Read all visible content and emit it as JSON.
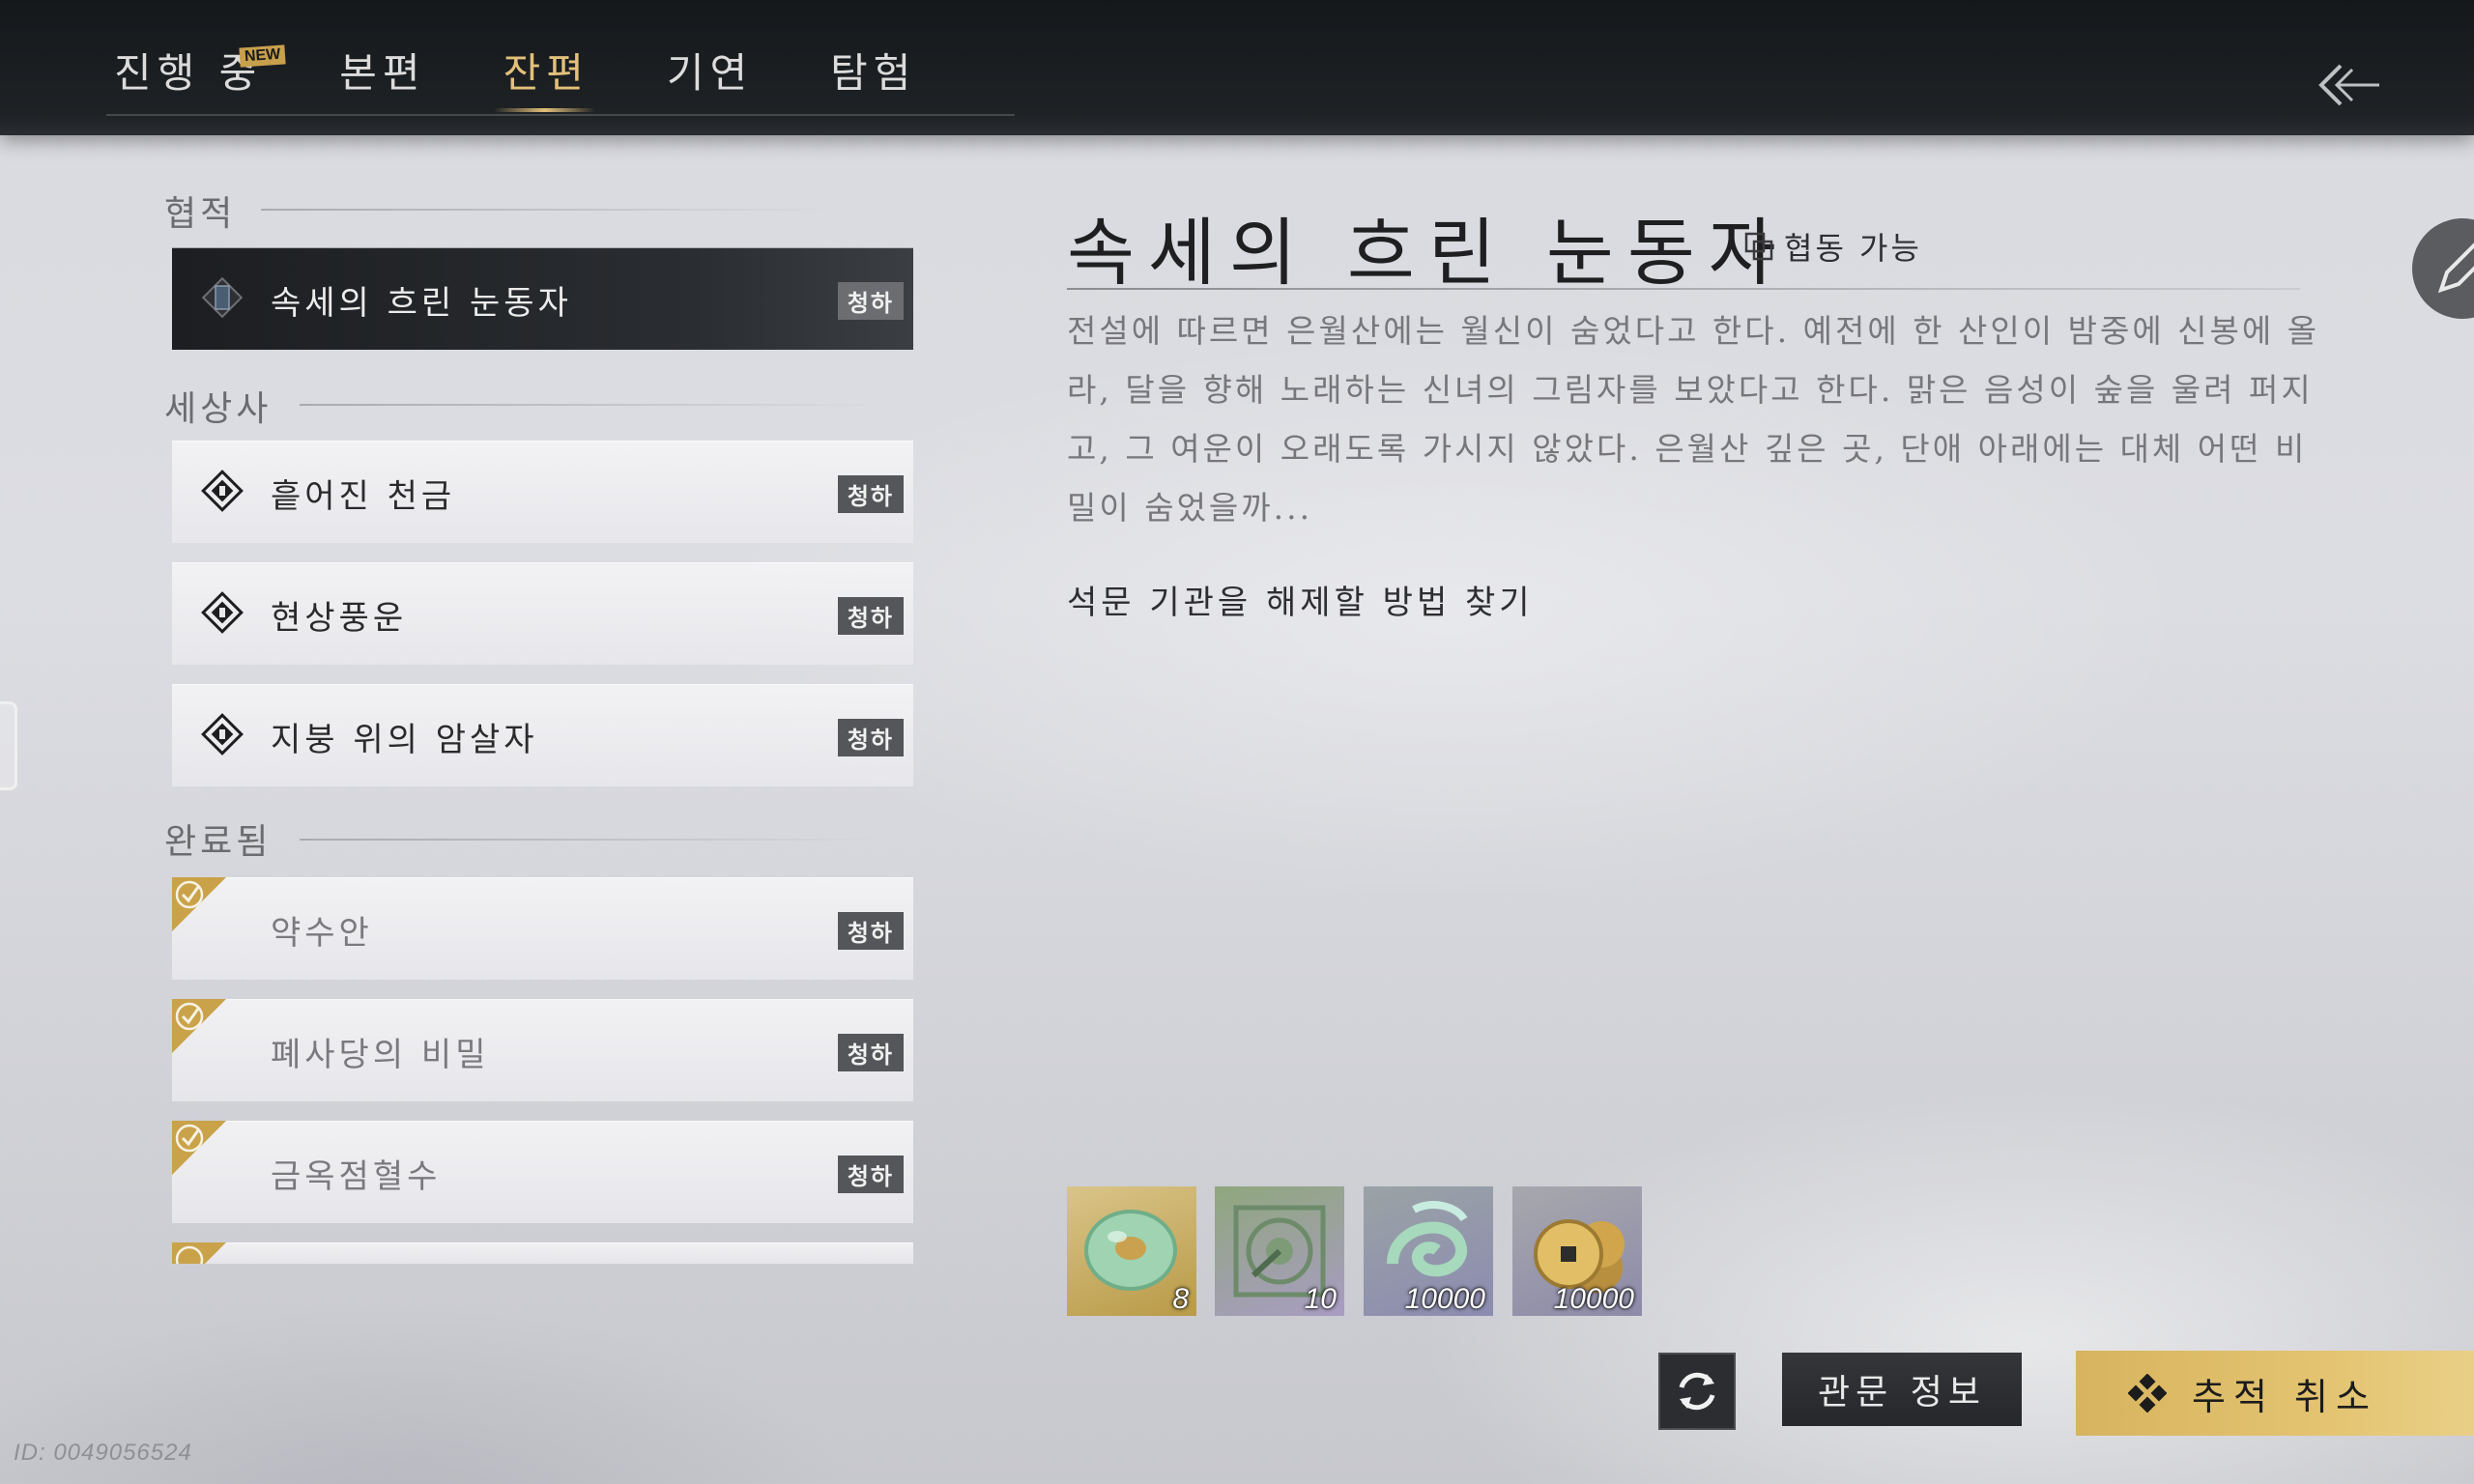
{
  "header": {
    "tabs": [
      {
        "label": "진행 중",
        "badge": "NEW"
      },
      {
        "label": "본편"
      },
      {
        "label": "잔편",
        "active": true
      },
      {
        "label": "기연"
      },
      {
        "label": "탐험"
      }
    ]
  },
  "quest_list": {
    "sections": [
      {
        "title": "협적",
        "items": [
          {
            "label": "속세의 흐린 눈동자",
            "tag": "청하",
            "selected": true
          }
        ]
      },
      {
        "title": "세상사",
        "items": [
          {
            "label": "흩어진 천금",
            "tag": "청하"
          },
          {
            "label": "현상풍운",
            "tag": "청하"
          },
          {
            "label": "지붕 위의 암살자",
            "tag": "청하"
          }
        ]
      },
      {
        "title": "완료됨",
        "items": [
          {
            "label": "약수안",
            "tag": "청하",
            "completed": true
          },
          {
            "label": "폐사당의 비밀",
            "tag": "청하",
            "completed": true
          },
          {
            "label": "금옥점혈수",
            "tag": "청하",
            "completed": true
          }
        ]
      }
    ]
  },
  "detail": {
    "title": "속세의 흐린 눈동자",
    "coop_label": "협동 가능",
    "description": "전설에 따르면 은월산에는 월신이 숨었다고 한다. 예전에 한 산인이 밤중에 신봉에 올라, 달을 향해 노래하는 신녀의 그림자를 보았다고 한다. 맑은 음성이 숲을 울려 퍼지고, 그 여운이 오래도록 가시지 않았다. 은월산 깊은 곳, 단애 아래에는 대체 어떤 비밀이 숨었을까...",
    "objective": "석문 기관을 해제할 방법 찾기",
    "rewards": [
      {
        "icon": "jade-ring-icon",
        "count": "8"
      },
      {
        "icon": "compass-icon",
        "count": "10"
      },
      {
        "icon": "wind-swirl-icon",
        "count": "10000"
      },
      {
        "icon": "coins-icon",
        "count": "10000"
      }
    ]
  },
  "actions": {
    "info_label": "관문 정보",
    "track_label": "추적 취소"
  },
  "footer": {
    "uid": "ID: 0049056524"
  },
  "colors": {
    "accent_gold": "#e3c07a",
    "tag_bg": "#555659"
  }
}
